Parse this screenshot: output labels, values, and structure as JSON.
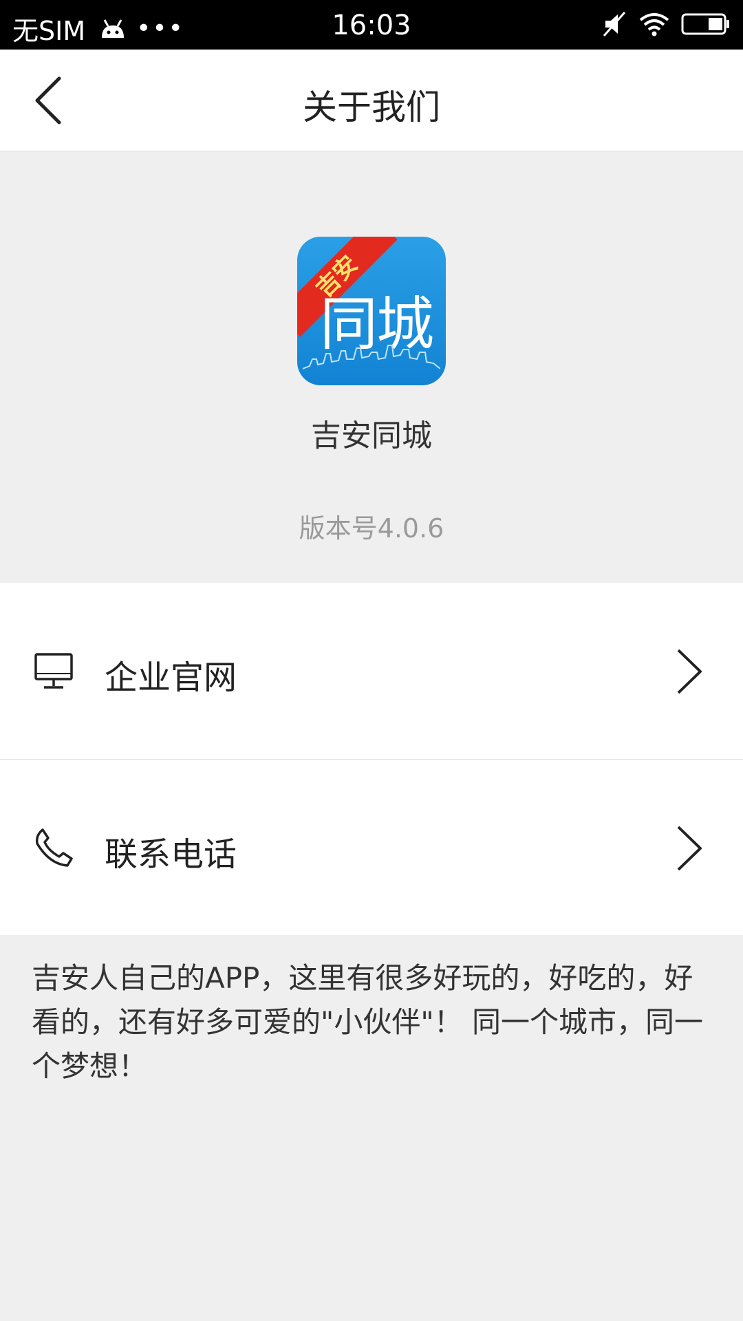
{
  "status_bar": {
    "carrier": "无SIM",
    "dots": "•••",
    "time": "16:03"
  },
  "nav": {
    "title": "关于我们"
  },
  "app": {
    "logo_ribbon": "吉安",
    "logo_text": "同城",
    "name": "吉安同城",
    "version": "版本号4.0.6"
  },
  "menu": {
    "items": [
      {
        "label": "企业官网",
        "icon": "monitor-icon"
      },
      {
        "label": "联系电话",
        "icon": "phone-icon"
      }
    ]
  },
  "description": "吉安人自己的APP，这里有很多好玩的，好吃的，好看的，还有好多可爱的\"小伙伴\"！ 同一个城市，同一个梦想！",
  "colors": {
    "status_bar_bg": "#000000",
    "page_bg": "#efefef",
    "logo_blue": "#1e90dd",
    "logo_ribbon_red": "#e32a1f"
  }
}
